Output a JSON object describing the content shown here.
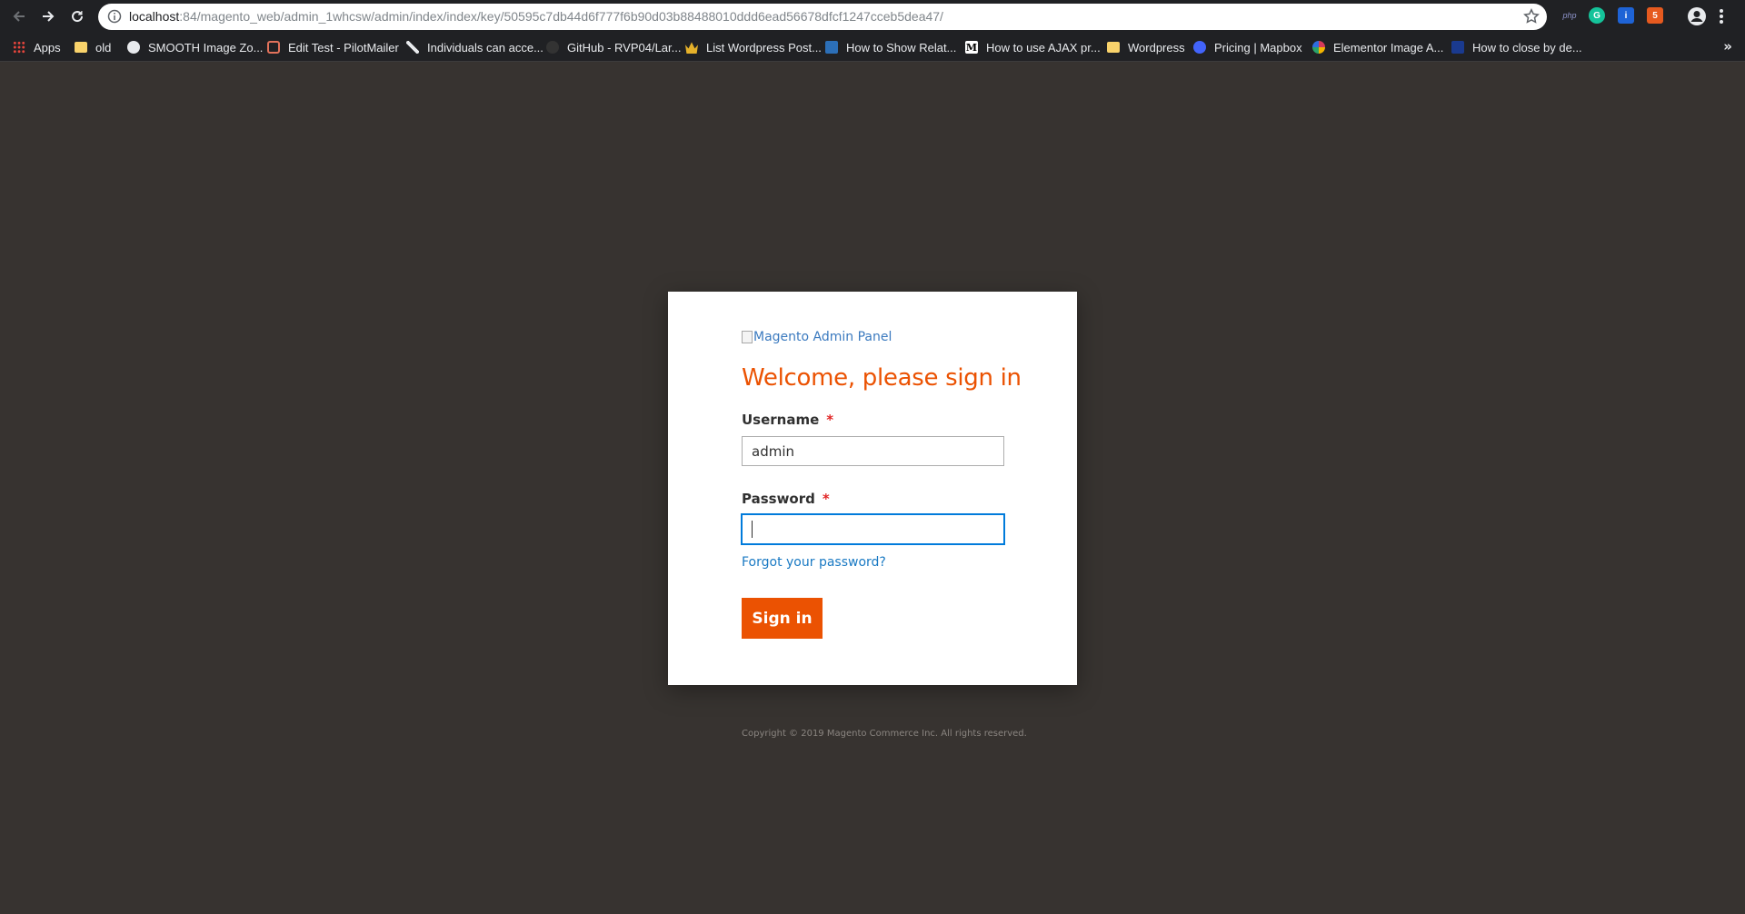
{
  "browser": {
    "url": {
      "host": "localhost",
      "rest": ":84/magento_web/admin_1whcsw/admin/index/index/key/50595c7db44d6f777f6b90d03b88488010ddd6ead56678dfcf1247cceb5dea47/"
    },
    "extensions": {
      "php": "php",
      "grammarly": "G",
      "info": "i",
      "html5": "5"
    },
    "bookmarks": [
      {
        "label": "Apps",
        "icon": "apps-grid-icon",
        "color": "#e8453c"
      },
      {
        "label": "old",
        "icon": "folder-icon",
        "color": "#f9d36b"
      },
      {
        "label": "SMOOTH Image Zo...",
        "icon": "globe-icon",
        "color": "#e8eaed"
      },
      {
        "label": "Edit Test - PilotMailer",
        "icon": "mail-icon",
        "color": "#e2725b"
      },
      {
        "label": "Individuals can acce...",
        "icon": "tools-icon",
        "color": "#e8eaed"
      },
      {
        "label": "GitHub - RVP04/Lar...",
        "icon": "github-icon",
        "color": "#333333"
      },
      {
        "label": "List Wordpress Post...",
        "icon": "crown-icon",
        "color": "#e5b12a"
      },
      {
        "label": "How to Show Relat...",
        "icon": "site-icon",
        "color": "#2c6fb7"
      },
      {
        "label": "How to use AJAX pr...",
        "icon": "medium-icon",
        "color": "#ffffff"
      },
      {
        "label": "Wordpress",
        "icon": "folder-icon",
        "color": "#f9d36b"
      },
      {
        "label": "Pricing | Mapbox",
        "icon": "mapbox-icon",
        "color": "#4264fb"
      },
      {
        "label": "Elementor Image A...",
        "icon": "elementor-icon",
        "color": "#d63a5a"
      },
      {
        "label": "How to close by de...",
        "icon": "site-icon",
        "color": "#1a3a8f"
      }
    ],
    "more_label": "»"
  },
  "login": {
    "logo_alt": "Magento Admin Panel",
    "title": "Welcome, please sign in",
    "username_label": "Username",
    "username_value": "admin",
    "password_label": "Password",
    "password_value": "",
    "required_mark": "*",
    "forgot_link": "Forgot your password?",
    "signin_label": "Sign in",
    "accent_color": "#eb5202"
  },
  "footer": {
    "copyright": "Copyright © 2019 Magento Commerce Inc. All rights reserved."
  }
}
